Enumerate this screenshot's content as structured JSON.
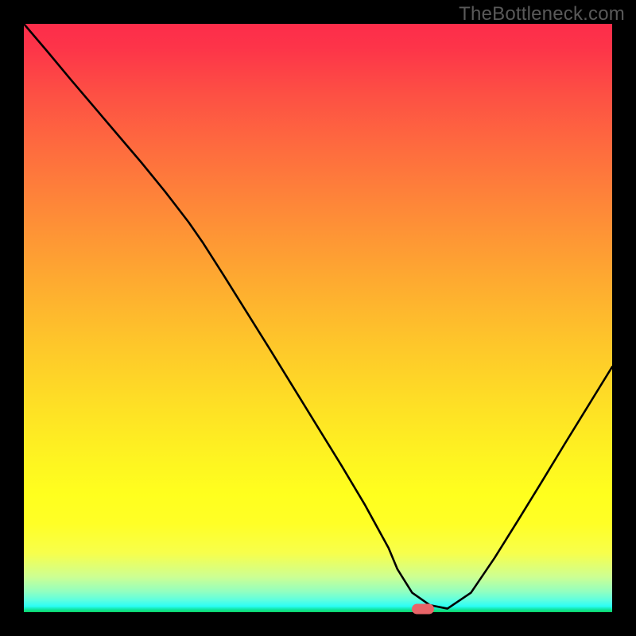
{
  "watermark": "TheBottleneck.com",
  "chart_data": {
    "type": "line",
    "title": "",
    "xlabel": "",
    "ylabel": "",
    "xlim": [
      0,
      100
    ],
    "ylim": [
      0,
      100
    ],
    "x": [
      0,
      4,
      8,
      12,
      16,
      20,
      24,
      28,
      30.5,
      34,
      38,
      42,
      46,
      50,
      54,
      58,
      62,
      63.5,
      66,
      69,
      72,
      76,
      80,
      84,
      88,
      92,
      96,
      100
    ],
    "y": [
      100,
      95.3,
      90.5,
      85.8,
      81.1,
      76.4,
      71.5,
      66.3,
      62.7,
      57.2,
      50.8,
      44.4,
      37.9,
      31.4,
      24.9,
      18.2,
      10.9,
      7.3,
      3.3,
      1.2,
      0.6,
      3.3,
      9.2,
      15.6,
      22.1,
      28.7,
      35.2,
      41.7
    ],
    "marker": {
      "x": 67.8,
      "y": 0.6
    },
    "axes_visible": false,
    "grid": false
  }
}
